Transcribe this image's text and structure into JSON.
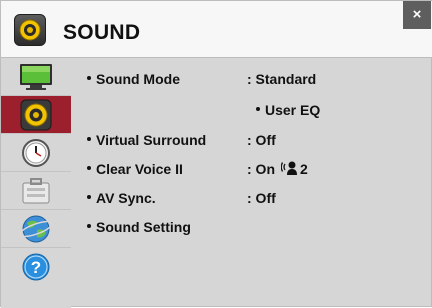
{
  "window": {
    "title": "SOUND",
    "close_label": "×"
  },
  "sidebar": {
    "items": [
      {
        "name": "picture",
        "icon": "tv-icon",
        "selected": false
      },
      {
        "name": "sound",
        "icon": "speaker-icon",
        "selected": true
      },
      {
        "name": "time",
        "icon": "clock-icon",
        "selected": false
      },
      {
        "name": "setup",
        "icon": "toolbox-icon",
        "selected": false
      },
      {
        "name": "network",
        "icon": "globe-icon",
        "selected": false
      },
      {
        "name": "support",
        "icon": "help-icon",
        "selected": false
      }
    ]
  },
  "settings": {
    "sound_mode": {
      "label": "Sound Mode",
      "value": ": Standard",
      "sub_value": "User EQ"
    },
    "virtual_surround": {
      "label": "Virtual Surround",
      "value": ": Off"
    },
    "clear_voice": {
      "label": "Clear Voice II",
      "value": ": On",
      "level": "2"
    },
    "av_sync": {
      "label": "AV Sync.",
      "value": ": Off"
    },
    "sound_setting": {
      "label": "Sound Setting"
    }
  },
  "colors": {
    "selected_item": "#9c1f2d",
    "panel": "#d6d6d6",
    "title_bar": "#f7f7f7"
  }
}
